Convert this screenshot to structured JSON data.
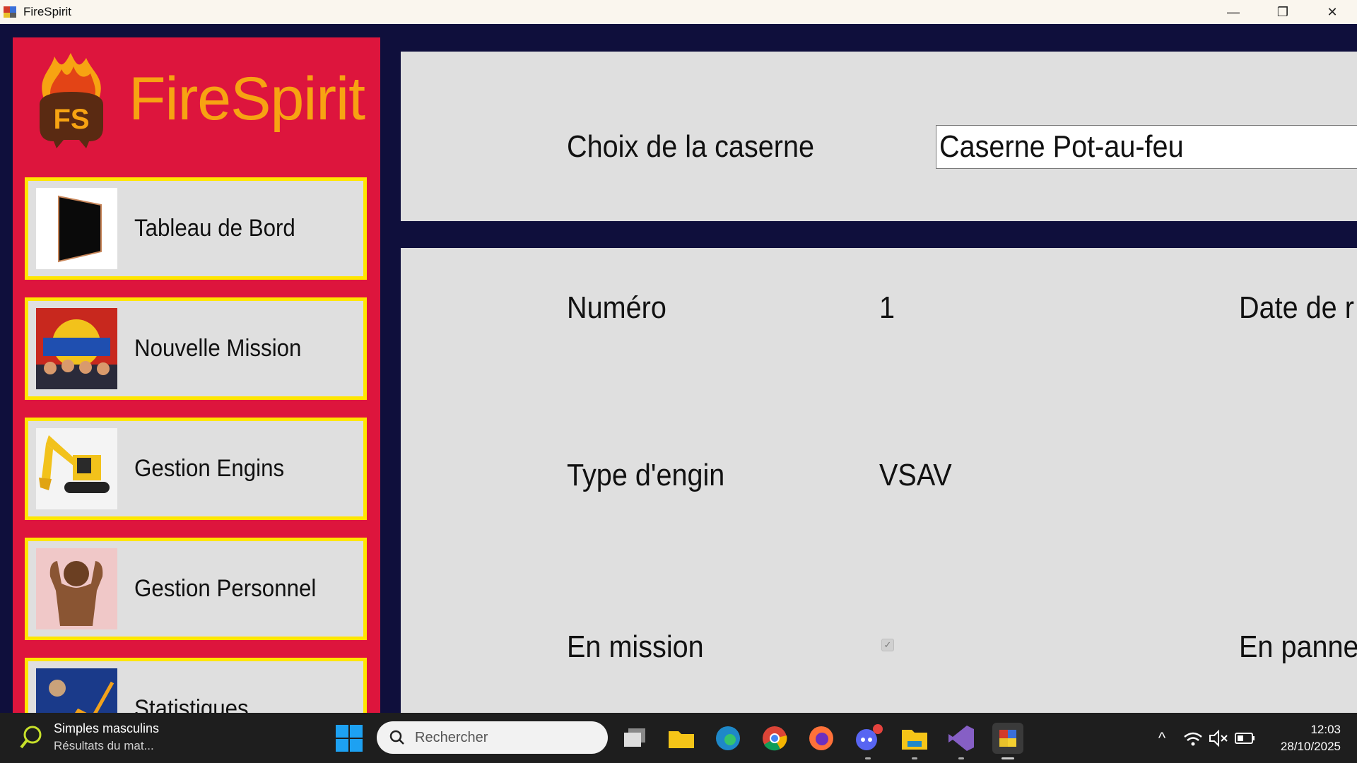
{
  "window": {
    "title": "FireSpirit",
    "minimize": "—",
    "restore": "❐",
    "close": "✕"
  },
  "brand": {
    "name": "FireSpirit",
    "logo_text": "FS"
  },
  "nav": [
    {
      "label": "Tableau de Bord"
    },
    {
      "label": "Nouvelle Mission"
    },
    {
      "label": "Gestion Engins"
    },
    {
      "label": "Gestion Personnel"
    },
    {
      "label": "Statistiques"
    }
  ],
  "caserne": {
    "label": "Choix de la caserne",
    "selected": "Caserne Pot-au-feu"
  },
  "engin": {
    "numero_label": "Numéro",
    "numero_value": "1",
    "date_label": "Date de r",
    "type_label": "Type d'engin",
    "type_value": "VSAV",
    "mission_label": "En mission",
    "mission_checked": true,
    "check_glyph": "✓",
    "panne_label": "En panne"
  },
  "taskbar": {
    "weather_title": "Simples masculins",
    "weather_sub": "Résultats du mat...",
    "search_placeholder": "Rechercher",
    "time": "12:03",
    "date": "28/10/2025",
    "tray_chevron": "^"
  },
  "colors": {
    "sidebar": "#dd153d",
    "frame": "#0f0f3c",
    "nav_border": "#ffe600",
    "brand": "#f7a312",
    "panel": "#dfdfdf"
  }
}
